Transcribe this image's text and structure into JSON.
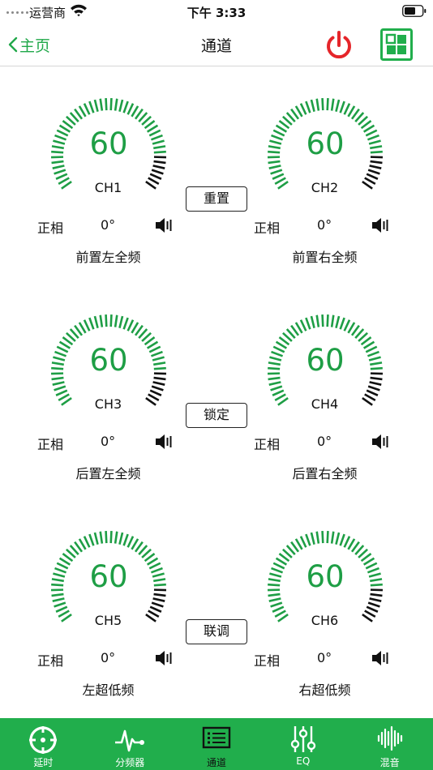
{
  "status_bar": {
    "carrier": "运营商",
    "time": "下午 3:33"
  },
  "nav": {
    "back_label": "主页",
    "title": "通道"
  },
  "colors": {
    "accent": "#21ae4c",
    "power": "#e5252a",
    "gauge_green": "#1e9e45",
    "gauge_black": "#111111"
  },
  "gauge_level": 0.85,
  "channels": [
    {
      "value": "60",
      "name": "CH1",
      "phase": "正相",
      "angle": "0°",
      "label": "前置左全频"
    },
    {
      "value": "60",
      "name": "CH2",
      "phase": "正相",
      "angle": "0°",
      "label": "前置右全频"
    },
    {
      "value": "60",
      "name": "CH3",
      "phase": "正相",
      "angle": "0°",
      "label": "后置左全频"
    },
    {
      "value": "60",
      "name": "CH4",
      "phase": "正相",
      "angle": "0°",
      "label": "后置右全频"
    },
    {
      "value": "60",
      "name": "CH5",
      "phase": "正相",
      "angle": "0°",
      "label": "左超低频"
    },
    {
      "value": "60",
      "name": "CH6",
      "phase": "正相",
      "angle": "0°",
      "label": "右超低频"
    }
  ],
  "buttons": {
    "reset": "重置",
    "lock": "锁定",
    "link": "联调"
  },
  "icons": {
    "power": "power-icon",
    "grid": "grid-icon",
    "speaker": "speaker-icon"
  },
  "tabs": [
    {
      "label": "延时",
      "icon": "crosshair-icon",
      "active": false
    },
    {
      "label": "分频器",
      "icon": "waveform-pulse-icon",
      "active": false
    },
    {
      "label": "通道",
      "icon": "list-icon",
      "active": true
    },
    {
      "label": "EQ",
      "icon": "sliders-icon",
      "active": false
    },
    {
      "label": "混音",
      "icon": "sound-wave-icon",
      "active": false
    }
  ]
}
